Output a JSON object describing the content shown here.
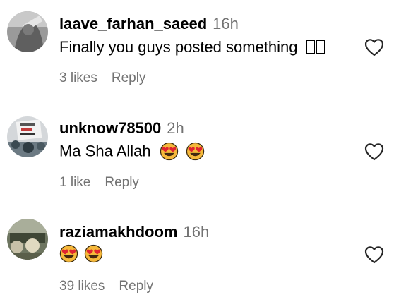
{
  "comments": [
    {
      "username": "laave_farhan_saeed",
      "time": "16h",
      "text": "Finally you guys posted something",
      "likes": "3 likes",
      "reply": "Reply"
    },
    {
      "username": "unknow78500",
      "time": "2h",
      "text": "Ma Sha Allah",
      "emoji": [
        "heart-eyes-emoji",
        "heart-eyes-emoji"
      ],
      "likes": "1 like",
      "reply": "Reply"
    },
    {
      "username": "raziamakhdoom",
      "time": "16h",
      "emoji": [
        "heart-eyes-emoji",
        "heart-eyes-emoji"
      ],
      "likes": "39 likes",
      "reply": "Reply"
    }
  ],
  "icons": {
    "like": "heart-outline-icon"
  },
  "colors": {
    "primary_text": "#000000",
    "secondary_text": "#737373",
    "emoji_face": "#F5B83A",
    "emoji_heart": "#E0242F"
  }
}
